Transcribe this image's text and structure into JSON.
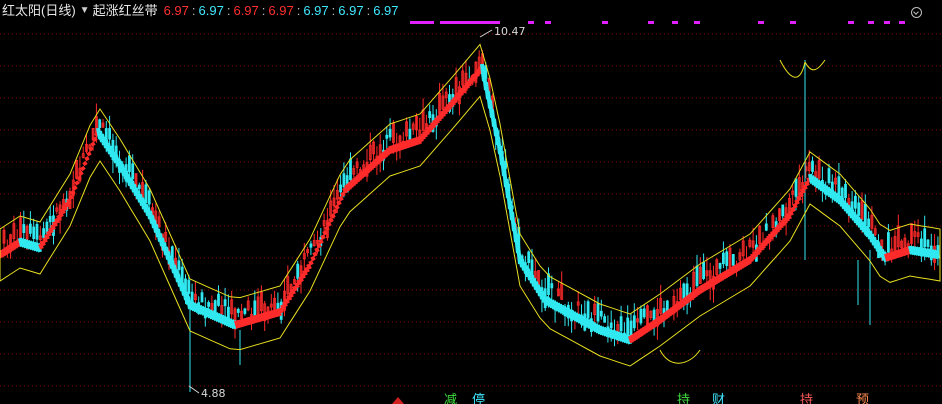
{
  "header": {
    "title": "红太阳(日线)",
    "indicator_name": "起涨红丝带",
    "values": [
      {
        "text": "6.97",
        "color": "red"
      },
      {
        "text": "6.97",
        "color": "cyan"
      },
      {
        "text": "6.97",
        "color": "red"
      },
      {
        "text": "6.97",
        "color": "red"
      },
      {
        "text": "6.97",
        "color": "cyan"
      },
      {
        "text": "6.97",
        "color": "cyan"
      },
      {
        "text": "6.97",
        "color": "cyan"
      }
    ]
  },
  "price_labels": {
    "high": "10.47",
    "low": "4.88"
  },
  "signals": [
    {
      "text": "减",
      "color": "#40e040"
    },
    {
      "text": "停",
      "color": "#40e8ff"
    },
    {
      "text": "持",
      "color": "#40e040"
    },
    {
      "text": "财",
      "color": "#40e8ff"
    },
    {
      "text": "持",
      "color": "#ff5a5a"
    },
    {
      "text": "预",
      "color": "#ff8c50"
    }
  ],
  "colors": {
    "background": "#000000",
    "grid": "#8a0000",
    "rise": "#ff2a2a",
    "fall": "#30e8f0",
    "outline": "#e8e020",
    "marker": "#e020ff"
  },
  "icons": {
    "dropdown": "triangle-down-icon",
    "corner": "expand-menu-icon"
  }
}
